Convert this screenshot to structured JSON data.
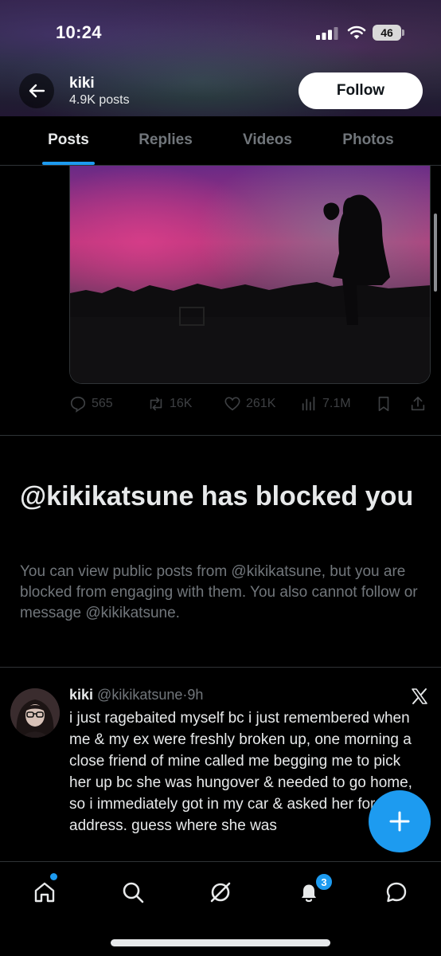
{
  "status_bar": {
    "time": "10:24",
    "battery": "46"
  },
  "header": {
    "display_name": "kiki",
    "post_count": "4.9K posts",
    "follow_label": "Follow"
  },
  "tabs": [
    {
      "label": "Posts",
      "active": true
    },
    {
      "label": "Replies",
      "active": false
    },
    {
      "label": "Videos",
      "active": false
    },
    {
      "label": "Photos",
      "active": false
    }
  ],
  "media_post": {
    "image_description": "aurora-silhouette-photo",
    "actions": {
      "replies": "565",
      "reposts": "16K",
      "likes": "261K",
      "views": "7.1M"
    }
  },
  "blocked_notice": {
    "title": "@kikikatsune has blocked you",
    "body": "You can view public posts from @kikikatsune, but you are blocked from engaging with them. You also cannot follow or message @kikikatsune."
  },
  "tweet": {
    "display_name": "kiki",
    "handle": "@kikikatsune",
    "separator": "·",
    "time": "9h",
    "text": "i just ragebaited myself bc i just remembered when me & my ex were freshly broken up, one morning a close friend of mine called me begging me to pick her up bc she was hungover & needed to go home, so i immediately got in my car & asked her for the address. guess where she was"
  },
  "bottom_nav": {
    "notifications_badge": "3"
  },
  "colors": {
    "accent": "#1d9bf0",
    "muted": "#71767b",
    "text": "#e7e9ea",
    "divider": "#2f3336"
  }
}
